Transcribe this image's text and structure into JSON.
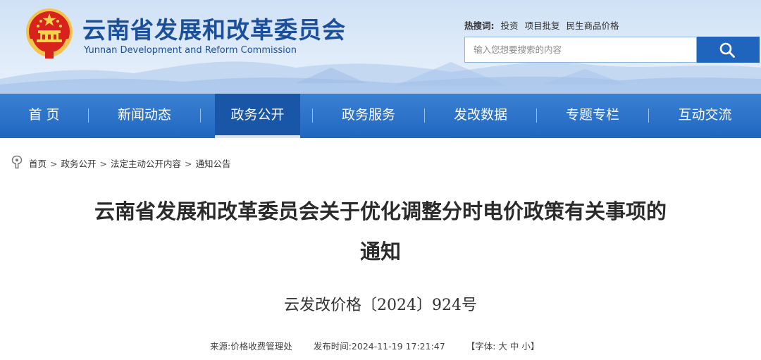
{
  "header": {
    "title": "云南省发展和改革委员会",
    "subtitle": "Yunnan Development and Reform Commission",
    "hot_label": "热搜词:",
    "hot_links": [
      "投资",
      "项目批复",
      "民生商品价格"
    ],
    "search_placeholder": "输入您想要搜索的内容"
  },
  "nav": {
    "items": [
      "首 页",
      "新闻动态",
      "政务公开",
      "政务服务",
      "发改数据",
      "专题专栏",
      "互动交流"
    ],
    "active_index": 2
  },
  "breadcrumb": [
    "首页",
    "政务公开",
    "法定主动公开内容",
    "通知公告"
  ],
  "breadcrumb_sep": ">",
  "article": {
    "title_line1": "云南省发展和改革委员会关于优化调整分时电价政策有关事项的",
    "title_line2": "通知",
    "doc_number": "云发改价格〔2024〕924号"
  },
  "meta": {
    "source": "来源:价格收费管理处",
    "published": "发布时间:2024-11-19 17:21:47",
    "font_label": "【字体:",
    "font_large": "大",
    "font_medium": "中",
    "font_small": "小",
    "font_close": "】"
  },
  "colors": {
    "brand_blue": "#1b4f9c",
    "nav_blue": "#2067c1",
    "nav_active": "#1a56a8",
    "search_button": "#1f64bd"
  }
}
